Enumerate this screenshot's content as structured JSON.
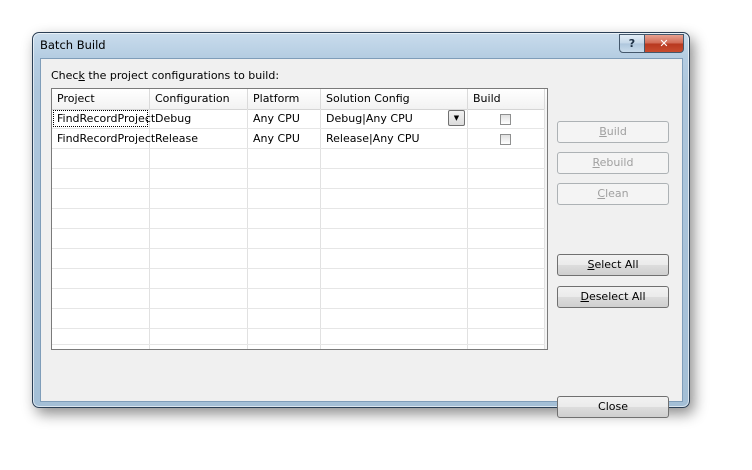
{
  "window": {
    "title": "Batch Build",
    "help_glyph": "?",
    "close_glyph": "✕"
  },
  "instruction": {
    "before": "Chec",
    "accel": "k",
    "after": " the project configurations to build:"
  },
  "grid": {
    "columns": [
      "Project",
      "Configuration",
      "Platform",
      "Solution Config",
      "Build"
    ],
    "rows": [
      {
        "project": "FindRecordProject",
        "configuration": "Debug",
        "platform": "Any CPU",
        "solution_config": "Debug|Any CPU",
        "build_checked": false
      },
      {
        "project": "FindRecordProject",
        "configuration": "Release",
        "platform": "Any CPU",
        "solution_config": "Release|Any CPU",
        "build_checked": false
      }
    ],
    "dropdown_glyph": "▼"
  },
  "buttons": {
    "build": {
      "accel": "B",
      "rest": "uild",
      "enabled": false
    },
    "rebuild": {
      "accel": "R",
      "rest": "ebuild",
      "enabled": false
    },
    "clean": {
      "accel": "C",
      "rest": "lean",
      "enabled": false
    },
    "select_all": {
      "accel": "S",
      "rest": "elect All",
      "enabled": true
    },
    "deselect_all": {
      "accel": "D",
      "rest": "eselect All",
      "enabled": true
    },
    "close": {
      "label": "Close",
      "enabled": true
    }
  }
}
